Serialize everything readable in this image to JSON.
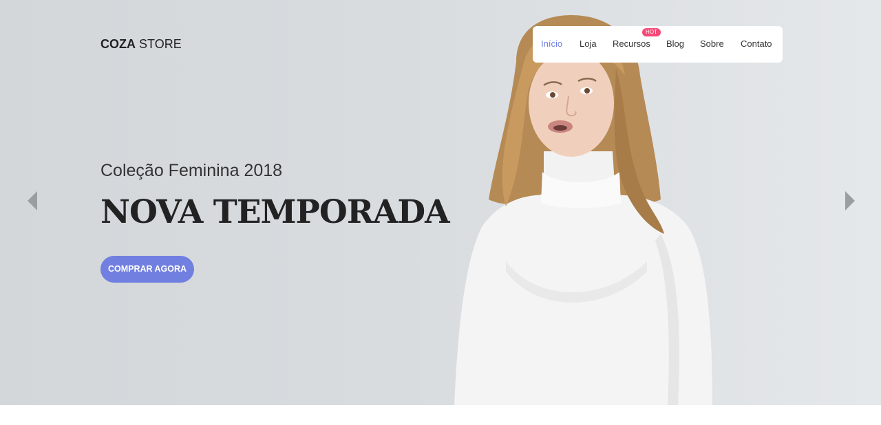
{
  "brand": {
    "name_bold": "COZA",
    "name_light": "STORE"
  },
  "nav": {
    "items": [
      {
        "label": "Início",
        "active": true
      },
      {
        "label": "Loja",
        "active": false
      },
      {
        "label": "Recursos",
        "active": false,
        "badge": "HOT"
      },
      {
        "label": "Blog",
        "active": false
      },
      {
        "label": "Sobre",
        "active": false
      },
      {
        "label": "Contato",
        "active": false
      }
    ]
  },
  "hero": {
    "subtitle": "Coleção Feminina 2018",
    "headline": "NOVA TEMPORADA",
    "cta_label": "COMPRAR AGORA",
    "prev_icon": "triangle-left-icon",
    "next_icon": "triangle-right-icon",
    "image": "woman-white-turtleneck-photo"
  },
  "colors": {
    "accent": "#717fe0",
    "hot_badge": "#f74877",
    "text_dark": "#222222",
    "hero_bg": "#d8dcdf"
  }
}
